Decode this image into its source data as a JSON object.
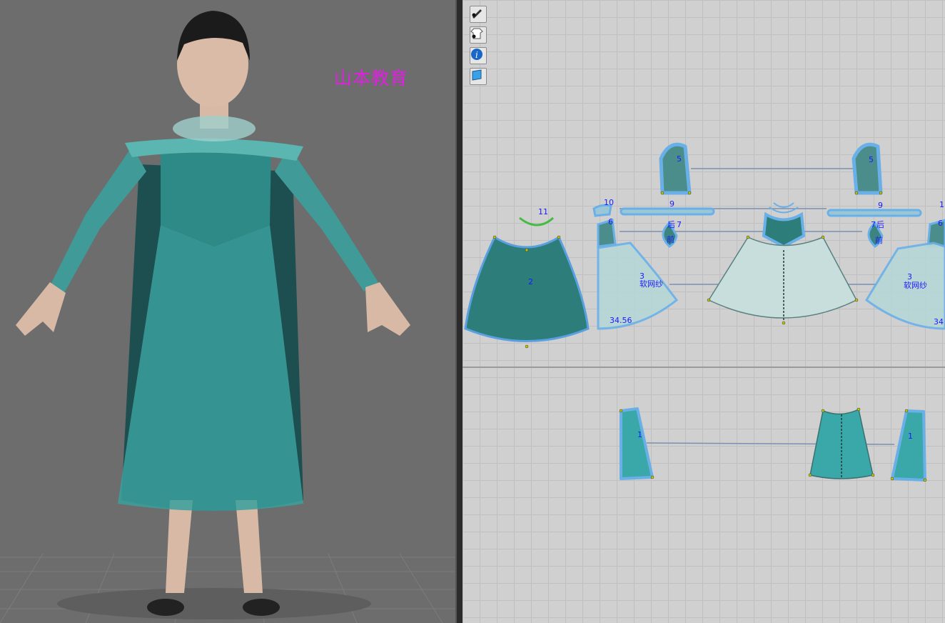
{
  "watermark": "山本教育",
  "toolbar": [
    {
      "icon": "pen-eye-icon"
    },
    {
      "icon": "garment-eye-icon"
    },
    {
      "icon": "info-icon"
    },
    {
      "icon": "fabric-icon"
    }
  ],
  "pieces": {
    "sleeve_left": "5",
    "sleeve_right": "5",
    "collar": "11",
    "skirt_lining": "2",
    "neck_band": "10",
    "strap_left": "9",
    "strap_right": "9",
    "bodice_left": "6",
    "bodice_right": "6",
    "ruffle_left_num": "7",
    "ruffle_left_back": "后",
    "ruffle_left_front": "前",
    "ruffle_right_num": "7",
    "ruffle_right_back": "后",
    "ruffle_right_front": "前",
    "skirt_left_num": "3",
    "skirt_left_fabric": "软网纱",
    "skirt_left_measure": "34.56",
    "skirt_right_num": "3",
    "skirt_right_fabric": "软网纱",
    "skirt_right_measure": "34",
    "cape_left": "1",
    "cape_right": "1",
    "extra_right_top": "1"
  },
  "colors": {
    "accent_teal": "#3aa8a8",
    "selection_blue": "#5aa0e0",
    "label_blue": "#1a1aff",
    "watermark_magenta": "#e020e0"
  }
}
